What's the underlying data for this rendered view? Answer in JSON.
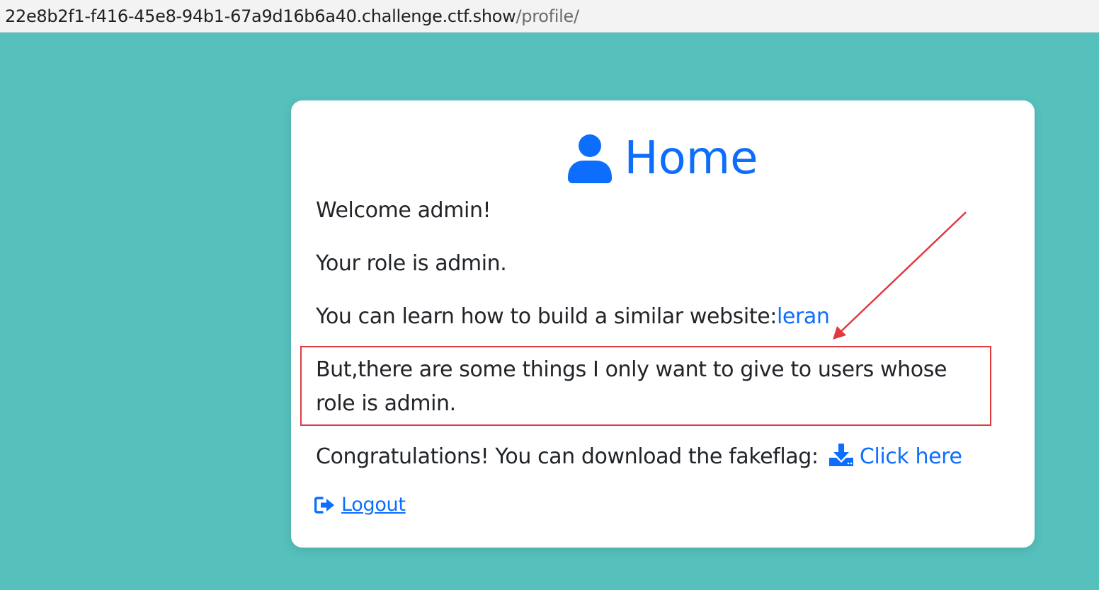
{
  "browser": {
    "url_host": "22e8b2f1-f416-45e8-94b1-67a9d16b6a40.challenge.ctf.show",
    "url_path": "/profile/"
  },
  "card": {
    "title": "Home",
    "title_icon": "user-icon",
    "welcome": "Welcome admin!",
    "role": "Your role is admin.",
    "learn_prefix": "You can learn how to build a similar website:",
    "learn_link": "leran",
    "notice": "But,there are some things I only want to give to users whose role is admin.",
    "congrats_prefix": "Congratulations! You can download the fakeflag:",
    "download_icon": "download-icon",
    "download_link": "Click here",
    "logout_icon": "sign-out-icon",
    "logout_label": "Logout"
  },
  "annotation": {
    "box_color": "#e0393e",
    "arrow_color": "#e0393e"
  },
  "colors": {
    "background": "#56c0bd",
    "accent": "#0d6efd",
    "text": "#212529"
  }
}
